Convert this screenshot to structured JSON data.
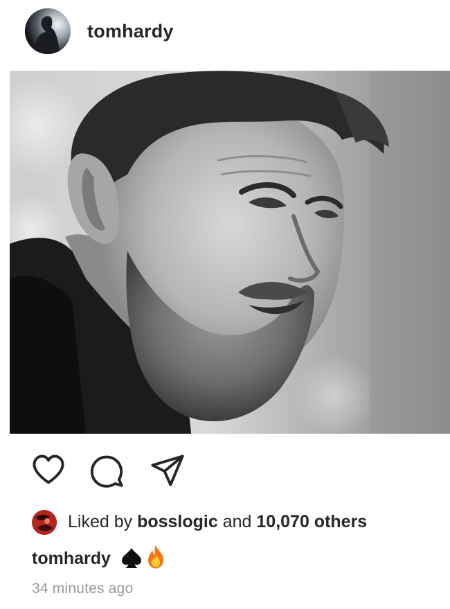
{
  "post": {
    "username": "tomhardy",
    "photo_desc_icon": "portrait-photo",
    "likes": {
      "prefix": "Liked by",
      "liker": "bosslogic",
      "joiner": "and",
      "others": "10,070 others"
    },
    "caption": {
      "username": "tomhardy",
      "emojis": [
        "spade-icon",
        "fire-icon"
      ]
    },
    "timestamp": "34 minutes ago"
  },
  "icons": {
    "like": "heart-icon",
    "comment": "comment-icon",
    "share": "share-icon"
  },
  "colors": {
    "text": "#262626",
    "muted": "#999999",
    "background": "#ffffff"
  }
}
